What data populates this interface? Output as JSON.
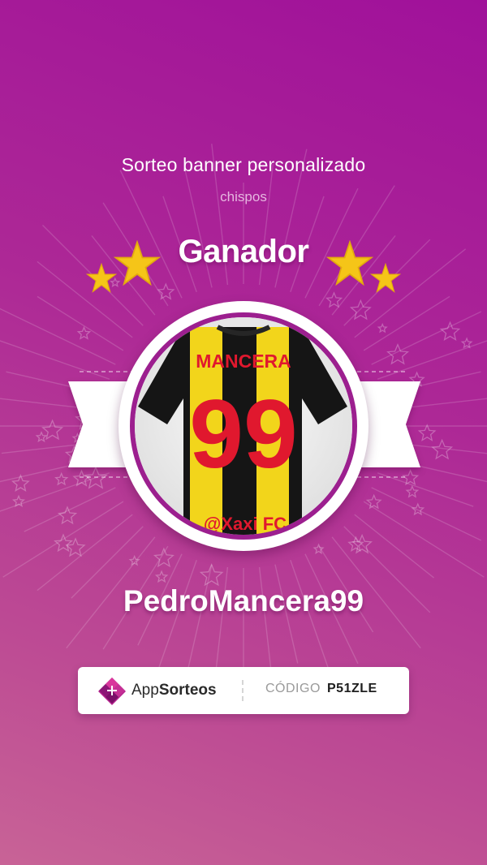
{
  "raffle": {
    "title": "Sorteo banner personalizado",
    "organizer": "chispos",
    "heading": "Ganador"
  },
  "winner": {
    "username": "PedroMancera99",
    "avatar": {
      "jersey_name": "MANCERA",
      "jersey_number": "99",
      "jersey_handle": "@Xaxi FC"
    }
  },
  "footer": {
    "brand_prefix": "App",
    "brand_suffix": "Sorteos",
    "code_label": "CÓDIGO",
    "code_value": "P51ZLE"
  },
  "colors": {
    "accent": "#a0119a",
    "star": "#f5c518",
    "jersey_red": "#e0182e",
    "jersey_yellow": "#f2d51b"
  },
  "icons": [
    "star-icon",
    "appsorteos-logo-icon"
  ]
}
